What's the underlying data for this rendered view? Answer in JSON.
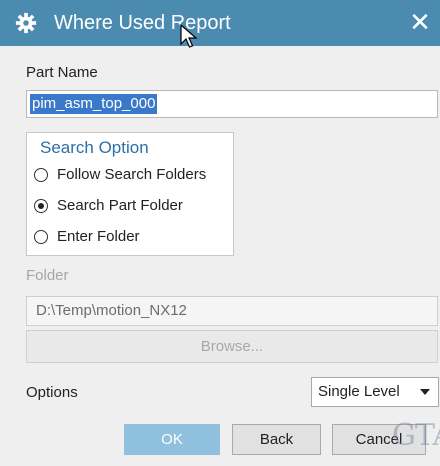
{
  "window": {
    "title": "Where Used Report",
    "title_icon": "gear-icon",
    "close_icon": "close-icon",
    "close_label": "✕"
  },
  "part_name": {
    "label": "Part Name",
    "value": "pim_asm_top_000"
  },
  "search_option": {
    "title": "Search Option",
    "options": [
      {
        "label": "Follow Search Folders",
        "selected": false
      },
      {
        "label": "Search Part Folder",
        "selected": true
      },
      {
        "label": "Enter Folder",
        "selected": false
      }
    ]
  },
  "folder": {
    "label": "Folder",
    "value": "D:\\Temp\\motion_NX12",
    "browse_label": "Browse...",
    "disabled": true
  },
  "options": {
    "label": "Options",
    "selected": "Single Level"
  },
  "buttons": {
    "ok": "OK",
    "back": "Back",
    "cancel": "Cancel"
  },
  "watermark": "GTA",
  "colors": {
    "titlebar": "#4c8bb0",
    "accent": "#2d6fa8",
    "selection": "#3a79c9",
    "ok_button": "#8fc0dd"
  }
}
